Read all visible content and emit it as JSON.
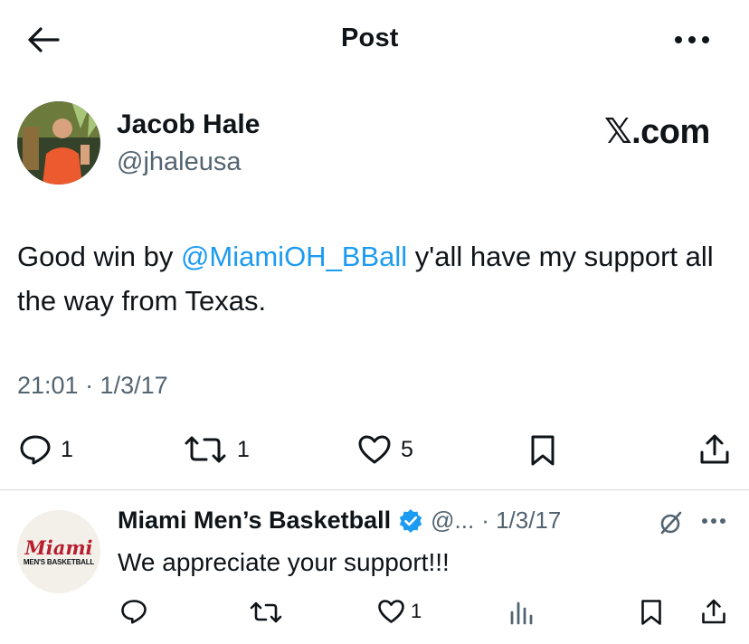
{
  "header": {
    "back_icon": "arrow-left-icon",
    "title": "Post",
    "more_icon": "more-horizontal-icon"
  },
  "tweet": {
    "author_name": "Jacob Hale",
    "author_handle": "@jhaleusa",
    "brand": "𝕏.com",
    "text_before": "Good win by ",
    "mention": "@MiamiOH_BBall",
    "text_after": " y'all have my support all the way from Texas.",
    "timestamp": "21:01 · 1/3/17",
    "actions": {
      "reply_count": "1",
      "repost_count": "1",
      "like_count": "5"
    }
  },
  "reply": {
    "author_name": "Miami Men’s Basketball",
    "verified_icon": "verified-badge-icon",
    "handle_trunc": "@...",
    "date": "· 1/3/17",
    "text": "We appreciate your support!!!",
    "avatar_text_top": "Miami",
    "avatar_text_bottom": "MEN'S BASKETBALL",
    "actions": {
      "like_count": "1"
    }
  },
  "colors": {
    "accent": "#1d9bf0",
    "secondary_text": "#536471",
    "miami_red": "#b61e2e"
  }
}
